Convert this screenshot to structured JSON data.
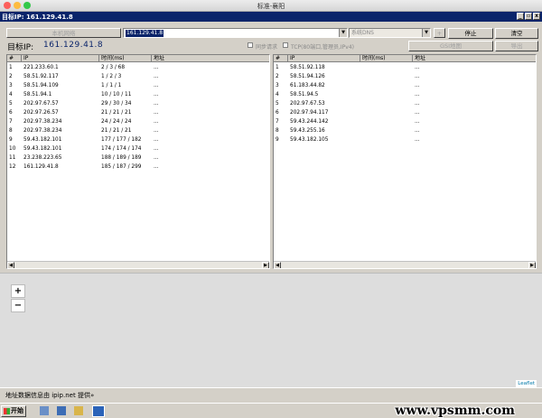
{
  "mac": {
    "title": "标准-襄阳"
  },
  "window": {
    "title": "目标IP:  161.129.41.8",
    "btn_min": "_",
    "btn_max": "▫",
    "btn_close": "x"
  },
  "toolbar": {
    "local_network": "本机网络",
    "ip_input_value": "161.129.41.8",
    "dns_combo": "系统DNS",
    "plus_button": "+",
    "stop_button": "停止",
    "clear_button": "清空",
    "gsi_button": "GSI地图",
    "export_button": "导出"
  },
  "target": {
    "label": "目标IP:",
    "ip": "161.129.41.8"
  },
  "options": {
    "sync_label": "同步请求",
    "tcp_label": "TCP(80端口,管理员,IPv4)"
  },
  "left_table": {
    "headers": [
      "#",
      "IP",
      "时间(ms)",
      "地址"
    ],
    "rows": [
      [
        "1",
        "221.233.60.1",
        "2 / 3 / 68",
        "..."
      ],
      [
        "2",
        "58.51.92.117",
        "1 / 2 / 3",
        "..."
      ],
      [
        "3",
        "58.51.94.109",
        "1 / 1 / 1",
        "..."
      ],
      [
        "4",
        "58.51.94.1",
        "10 / 10 / 11",
        "..."
      ],
      [
        "5",
        "202.97.67.57",
        "29 / 30 / 34",
        "..."
      ],
      [
        "6",
        "202.97.26.57",
        "21 / 21 / 21",
        "..."
      ],
      [
        "7",
        "202.97.38.234",
        "24 / 24 / 24",
        "..."
      ],
      [
        "8",
        "202.97.38.234",
        "21 / 21 / 21",
        "..."
      ],
      [
        "9",
        "59.43.182.101",
        "177 / 177 / 182",
        "..."
      ],
      [
        "10",
        "59.43.182.101",
        "174 / 174 / 174",
        "..."
      ],
      [
        "11",
        "23.238.223.65",
        "188 / 189 / 189",
        "..."
      ],
      [
        "12",
        "161.129.41.8",
        "185 / 187 / 299",
        "..."
      ]
    ]
  },
  "right_table": {
    "headers": [
      "#",
      "IP",
      "时间(ms)",
      "地址"
    ],
    "rows": [
      [
        "1",
        "58.51.92.118",
        "",
        "..."
      ],
      [
        "2",
        "58.51.94.126",
        "",
        "..."
      ],
      [
        "3",
        "61.183.44.82",
        "",
        "..."
      ],
      [
        "4",
        "58.51.94.5",
        "",
        "..."
      ],
      [
        "5",
        "202.97.67.53",
        "",
        "..."
      ],
      [
        "6",
        "202.97.94.117",
        "",
        "..."
      ],
      [
        "7",
        "59.43.244.142",
        "",
        "..."
      ],
      [
        "8",
        "59.43.255.16",
        "",
        "..."
      ],
      [
        "9",
        "59.43.182.105",
        "",
        "..."
      ]
    ]
  },
  "map": {
    "zoom_in": "+",
    "zoom_out": "−",
    "attribution": "Leaflet"
  },
  "status": {
    "text": "地址数据信息由 ipip.net 提供»"
  },
  "taskbar": {
    "start_label": "开始",
    "watermark": "www.vpsmm.com"
  },
  "colors": {
    "titlebar": "#0a246a",
    "face": "#d4d0c8",
    "selection": "#0a246a"
  }
}
